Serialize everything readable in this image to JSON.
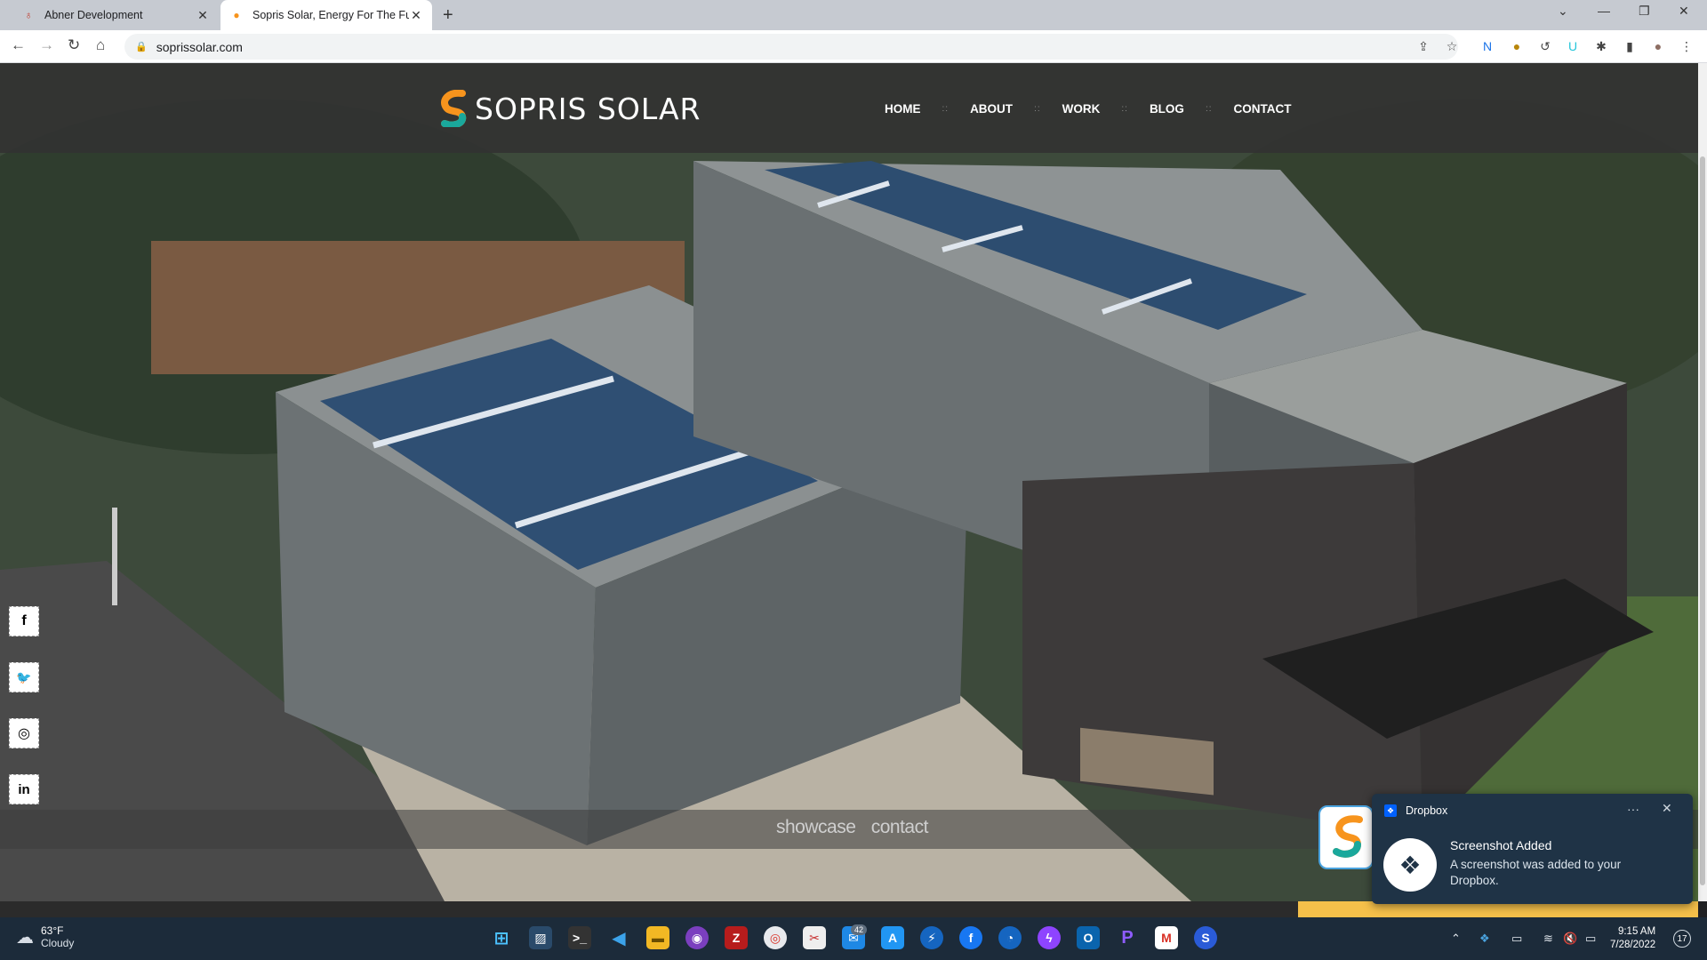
{
  "browser": {
    "tabs": [
      {
        "title": "Abner Development",
        "active": false
      },
      {
        "title": "Sopris Solar, Energy For The Futu",
        "active": true
      }
    ],
    "new_tab": "+",
    "url": "soprissolar.com",
    "window_controls": {
      "minimize": "—",
      "restore": "❐",
      "close": "✕",
      "dropdown": "⌄"
    }
  },
  "site": {
    "brand": "SOPRIS SOLAR",
    "nav": [
      "HOME",
      "ABOUT",
      "WORK",
      "BLOG",
      "CONTACT"
    ],
    "nav_separator": "::",
    "social": [
      {
        "name": "facebook",
        "glyph": "f"
      },
      {
        "name": "twitter",
        "glyph": "🐦"
      },
      {
        "name": "instagram",
        "glyph": "◎"
      },
      {
        "name": "linkedin",
        "glyph": "in"
      }
    ],
    "band_links": [
      "showcase",
      "contact"
    ],
    "colors": {
      "header_bg": "#323232",
      "logo_orange": "#f7941d",
      "logo_teal": "#1aa89c"
    }
  },
  "toast": {
    "app": "Dropbox",
    "more": "···",
    "close": "✕",
    "title": "Screenshot Added",
    "body": "A screenshot was added to your Dropbox.",
    "bg": "#1f3346"
  },
  "taskbar": {
    "weather_temp": "63°F",
    "weather_cond": "Cloudy",
    "mail_badge": "42",
    "time": "9:15 AM",
    "date": "7/28/2022",
    "notifications": "17"
  }
}
